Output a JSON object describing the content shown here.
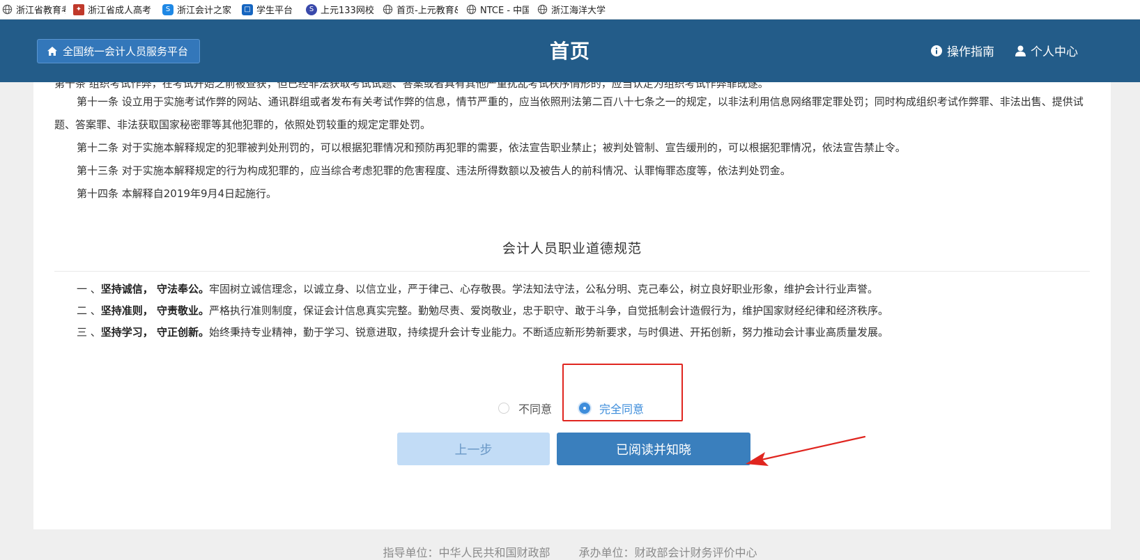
{
  "bookmarks": [
    {
      "label": "浙江省教育考试",
      "icon": "globe-icon",
      "color": "#6b6b6b"
    },
    {
      "label": "浙江省成人高考",
      "icon": "site-logo-icon",
      "color": "#c0392b"
    },
    {
      "label": "浙江会计之家",
      "icon": "site-logo-icon",
      "color": "#1e88e5"
    },
    {
      "label": "学生平台",
      "icon": "site-logo-icon",
      "color": "#1565c0"
    },
    {
      "label": "上元133网校",
      "icon": "site-logo-icon",
      "color": "#3949ab"
    },
    {
      "label": "首页-上元教育&",
      "icon": "globe-icon",
      "color": "#6b6b6b"
    },
    {
      "label": "NTCE - 中国教",
      "icon": "globe-icon",
      "color": "#6b6b6b"
    },
    {
      "label": "浙江海洋大学",
      "icon": "globe-icon",
      "color": "#6b6b6b"
    }
  ],
  "header": {
    "platform_label": "全国统一会计人员服务平台",
    "title": "首页",
    "guide_label": "操作指南",
    "personal_label": "个人中心",
    "bg_color": "#235c89"
  },
  "content": {
    "cut_line": "第十条 组织考试作弊，在考试开始之前被查获，但已经非法获取考试试题、答案或者具有其他严重扰乱考试秩序情形的，应当认定为组织考试作弊罪既遂。",
    "article_11": "第十一条 设立用于实施考试作弊的网站、通讯群组或者发布有关考试作弊的信息，情节严重的，应当依照刑法第二百八十七条之一的规定，以非法利用信息网络罪定罪处罚；同时构成组织考试作弊罪、非法出售、提供试题、答案罪、非法获取国家秘密罪等其他犯罪的，依照处罚较重的规定定罪处罚。",
    "article_12": "第十二条 对于实施本解释规定的犯罪被判处刑罚的，可以根据犯罪情况和预防再犯罪的需要，依法宣告职业禁止；被判处管制、宣告缓刑的，可以根据犯罪情况，依法宣告禁止令。",
    "article_13": "第十三条 对于实施本解释规定的行为构成犯罪的，应当综合考虑犯罪的危害程度、违法所得数额以及被告人的前科情况、认罪悔罪态度等，依法判处罚金。",
    "article_14": "第十四条 本解释自2019年9月4日起施行。",
    "ethics_title": "会计人员职业道德规范",
    "ethics": [
      {
        "num": "一 、",
        "heading": "坚持诚信，  守法奉公。",
        "text": "牢固树立诚信理念，以诚立身、以信立业，严于律己、心存敬畏。学法知法守法，公私分明、克己奉公，树立良好职业形象，维护会计行业声誉。"
      },
      {
        "num": "二 、",
        "heading": "坚持准则，  守责敬业。",
        "text": "严格执行准则制度，保证会计信息真实完整。勤勉尽责、爱岗敬业，忠于职守、敢于斗争，自觉抵制会计造假行为，维护国家财经纪律和经济秩序。"
      },
      {
        "num": "三 、",
        "heading": "坚持学习，  守正创新。",
        "text": "始终秉持专业精神，勤于学习、锐意进取，持续提升会计专业能力。不断适应新形势新要求，与时俱进、开拓创新，努力推动会计事业高质量发展。"
      }
    ]
  },
  "consent": {
    "disagree_label": "不同意",
    "agree_label": "完全同意",
    "selected": "agree",
    "accent_color": "#3e8ddb",
    "annotation_color": "#e0251f"
  },
  "buttons": {
    "prev_label": "上一步",
    "read_label": "已阅读并知晓"
  },
  "footer": {
    "guide_unit": "指导单位：中华人民共和国财政部",
    "host_unit": "承办单位：财政部会计财务评价中心"
  }
}
